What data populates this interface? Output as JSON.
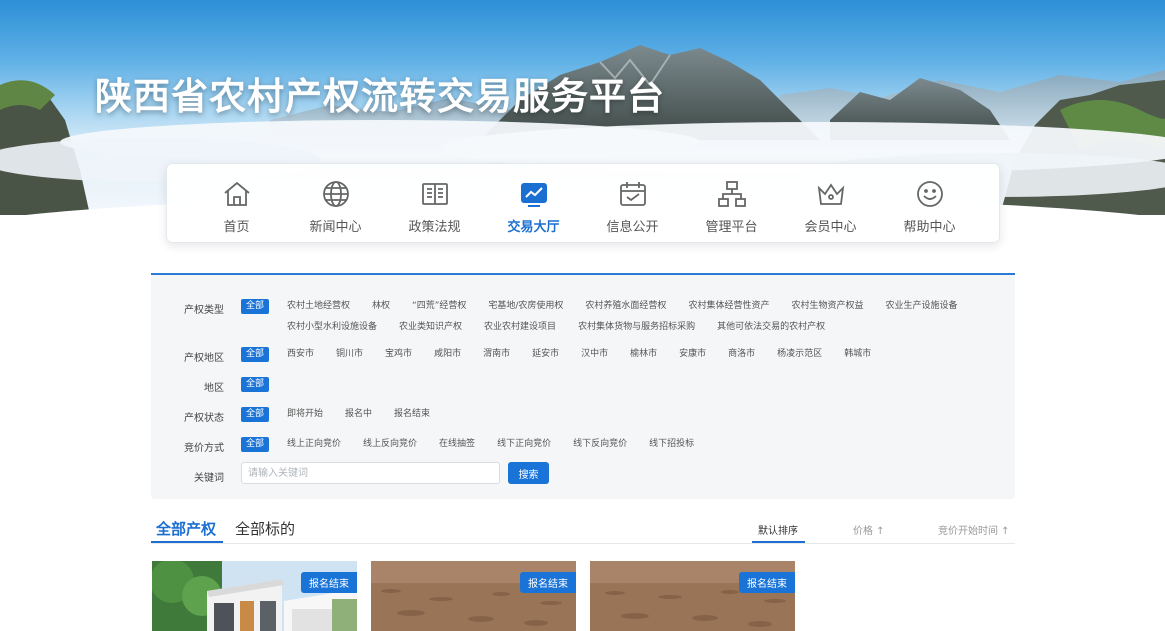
{
  "site_title": "陕西省农村产权流转交易服务平台",
  "nav": {
    "items": [
      {
        "label": "首页",
        "icon": "home-icon"
      },
      {
        "label": "新闻中心",
        "icon": "globe-icon"
      },
      {
        "label": "政策法规",
        "icon": "book-icon"
      },
      {
        "label": "交易大厅",
        "icon": "chart-icon"
      },
      {
        "label": "信息公开",
        "icon": "calendar-icon"
      },
      {
        "label": "管理平台",
        "icon": "org-icon"
      },
      {
        "label": "会员中心",
        "icon": "crown-icon"
      },
      {
        "label": "帮助中心",
        "icon": "smile-icon"
      }
    ],
    "active_label": "交易大厅"
  },
  "filters": {
    "all_label": "全部",
    "rows": [
      {
        "label": "产权类型",
        "options": [
          "农村土地经营权",
          "林权",
          "“四荒”经营权",
          "宅基地/农房使用权",
          "农村养殖水面经营权",
          "农村集体经营性资产",
          "农村生物资产权益",
          "农业生产设施设备",
          "农村小型水利设施设备",
          "农业类知识产权",
          "农业农村建设项目",
          "农村集体货物与服务招标采购",
          "其他可依法交易的农村产权"
        ]
      },
      {
        "label": "产权地区",
        "options": [
          "西安市",
          "铜川市",
          "宝鸡市",
          "咸阳市",
          "渭南市",
          "延安市",
          "汉中市",
          "榆林市",
          "安康市",
          "商洛市",
          "杨凌示范区",
          "韩城市"
        ]
      },
      {
        "label": "地区",
        "options": []
      },
      {
        "label": "产权状态",
        "options": [
          "即将开始",
          "报名中",
          "报名结束"
        ]
      },
      {
        "label": "竞价方式",
        "options": [
          "线上正向竞价",
          "线上反向竞价",
          "在线抽签",
          "线下正向竞价",
          "线下反向竞价",
          "线下招投标"
        ]
      }
    ],
    "keyword_label": "关键词",
    "keyword_placeholder": "请输入关键词",
    "keyword_value": "",
    "search_label": "搜索"
  },
  "tabs": {
    "all_property": "全部产权",
    "all_targets": "全部标的",
    "sort_default": "默认排序",
    "sort_price": "价格 ↑",
    "sort_start": "竞价开始时间 ↑"
  },
  "listings": [
    {
      "badge": "报名结束",
      "image": "house"
    },
    {
      "badge": "报名结束",
      "image": "farmland"
    },
    {
      "badge": "报名结束",
      "image": "farmland"
    }
  ],
  "colors": {
    "primary": "#1a74d8",
    "title": "#ffffff",
    "panel": "#f5f6f8"
  }
}
